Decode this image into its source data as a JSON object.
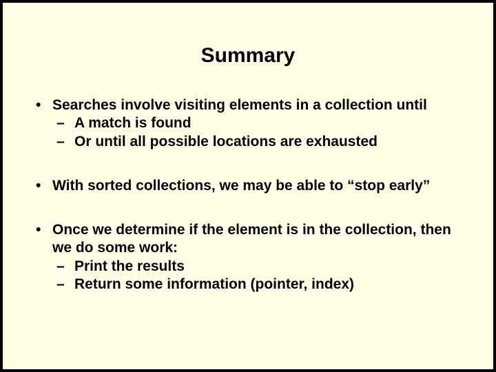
{
  "title": "Summary",
  "bullets": [
    {
      "text": "Searches involve visiting elements in a collection until",
      "subs": [
        "A match is found",
        "Or until all possible locations are exhausted"
      ]
    },
    {
      "text": "With sorted collections, we may be able to “stop early”",
      "subs": []
    },
    {
      "text": "Once we determine if the element is in the collection, then we do some work:",
      "subs": [
        "Print the results",
        "Return some information (pointer, index)"
      ]
    }
  ]
}
